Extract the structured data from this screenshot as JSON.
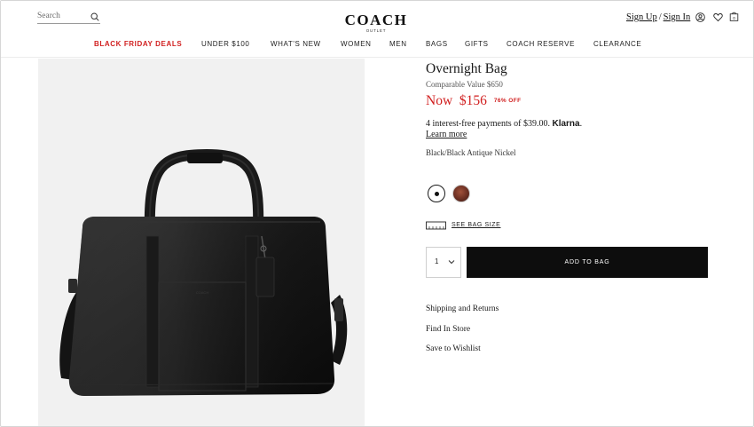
{
  "header": {
    "search_placeholder": "Search",
    "logo": "COACH",
    "logo_sub": "OUTLET",
    "sign_up": "Sign Up",
    "separator": "/",
    "sign_in": "Sign In",
    "bag_count": "0"
  },
  "nav": [
    {
      "label": "BLACK FRIDAY DEALS",
      "sale": true
    },
    {
      "label": "UNDER $100"
    },
    {
      "label": "WHAT'S NEW"
    },
    {
      "label": "WOMEN"
    },
    {
      "label": "MEN"
    },
    {
      "label": "BAGS"
    },
    {
      "label": "GIFTS"
    },
    {
      "label": "COACH RESERVE"
    },
    {
      "label": "CLEARANCE"
    }
  ],
  "product": {
    "title": "Overnight Bag",
    "comparable": "Comparable Value $650",
    "price_now": "Now  $156",
    "price_off": "76% OFF",
    "installments_text": "4 interest-free payments of $39.00.",
    "klarna": "Klarna",
    "klarna_suffix": ".",
    "learn_more": "Learn more",
    "color_name": "Black/Black Antique Nickel",
    "bag_size_label": "SEE BAG SIZE",
    "quantity": "1",
    "add_to_bag": "ADD TO BAG",
    "links": [
      "Shipping and Returns",
      "Find In Store",
      "Save to Wishlist"
    ]
  },
  "colors": {
    "sale_red": "#d11f1f",
    "button_black": "#0d0d0d"
  }
}
